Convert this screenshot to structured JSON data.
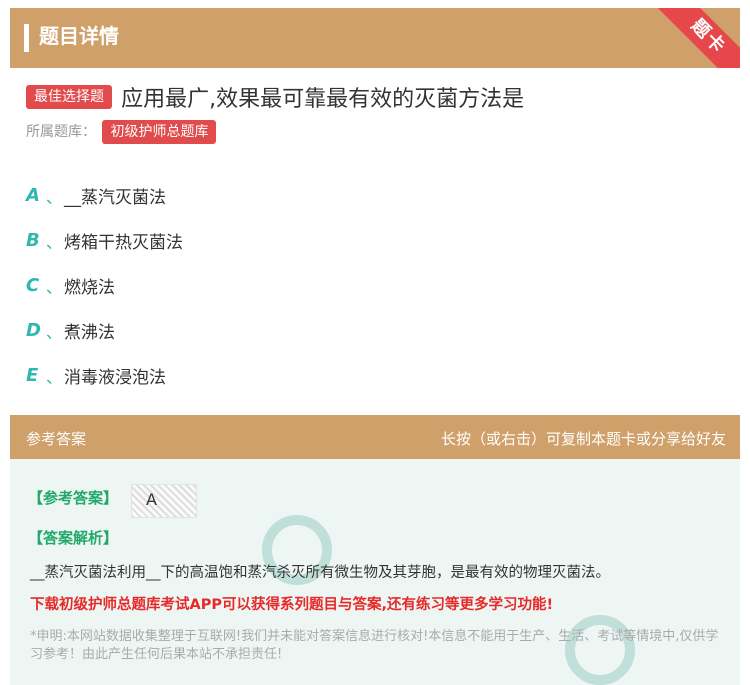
{
  "header": {
    "title": "题目详情",
    "ribbon": "题卡"
  },
  "question": {
    "type_badge": "最佳选择题",
    "title": "应用最广,效果最可靠最有效的灭菌方法是",
    "bank_label": "所属题库：",
    "bank_name": "初级护师总题库"
  },
  "options": [
    {
      "letter": "A",
      "sep": "、",
      "text": "__蒸汽灭菌法"
    },
    {
      "letter": "B",
      "sep": "、",
      "text": "烤箱干热灭菌法"
    },
    {
      "letter": "C",
      "sep": "、",
      "text": "燃烧法"
    },
    {
      "letter": "D",
      "sep": "、",
      "text": "煮沸法"
    },
    {
      "letter": "E",
      "sep": "、",
      "text": "消毒液浸泡法"
    }
  ],
  "answer": {
    "head_left": "参考答案",
    "head_right": "长按（或右击）可复制本题卡或分享给好友",
    "ref_label": "【参考答案】",
    "ref_value": "A",
    "analysis_label": "【答案解析】",
    "analysis_text": "__蒸汽灭菌法利用__下的高温饱和蒸汽杀灭所有微生物及其芽胞，是最有效的物理灭菌法。",
    "promo": "下载初级护师总题库考试APP可以获得系列题目与答案,还有练习等更多学习功能!",
    "disclaimer": "*申明:本网站数据收集整理于互联网!我们并未能对答案信息进行核对!本信息不能用于生产、生活、考试等情境中,仅供学习参考！由此产生任何后果本站不承担责任!"
  },
  "colors": {
    "header_bg": "#cfa06a",
    "accent_red": "#e14b4b",
    "option_teal": "#30b7b0",
    "answer_green": "#22a86b"
  }
}
